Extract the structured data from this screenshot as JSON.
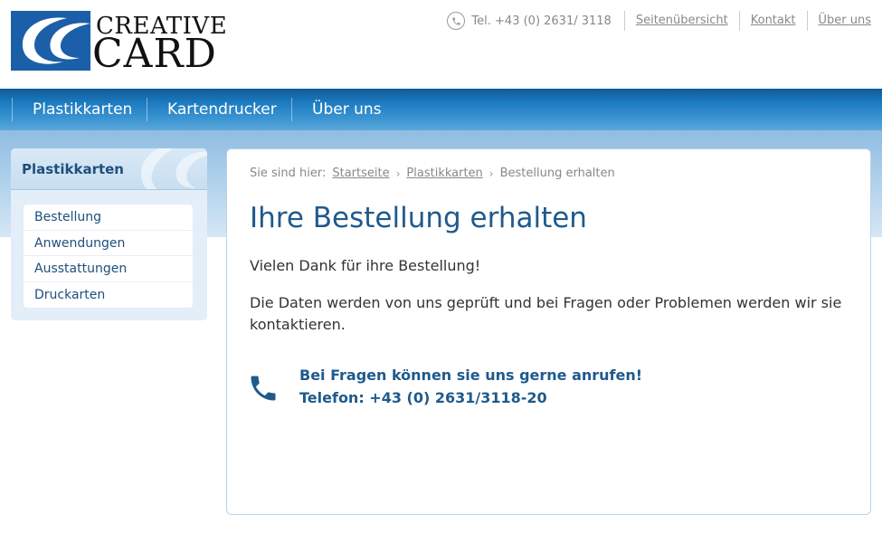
{
  "brand": {
    "name_top": "CREATIVE",
    "name_bottom": "CARD",
    "logo_icon": "cc-swoosh-logo-icon",
    "color_blue": "#1b5fa8"
  },
  "topnav": {
    "phone_icon": "phone-icon",
    "phone": "Tel. +43 (0) 2631/ 3118",
    "links": [
      "Seitenübersicht",
      "Kontakt",
      "Über uns"
    ]
  },
  "mainnav": {
    "items": [
      "Plastikkarten",
      "Kartendrucker",
      "Über uns"
    ]
  },
  "sidebar": {
    "title": "Plastikkarten",
    "items": [
      "Bestellung",
      "Anwendungen",
      "Ausstattungen",
      "Druckarten"
    ]
  },
  "breadcrumb": {
    "prefix": "Sie sind hier:",
    "items": [
      "Startseite",
      "Plastikkarten",
      "Bestellung erhalten"
    ]
  },
  "content": {
    "title": "Ihre Bestellung erhalten",
    "thanks": "Vielen Dank für ihre Bestellung!",
    "info": "Die Daten werden von uns geprüft und bei Fragen oder Problemen werden wir sie kontaktieren.",
    "contact_icon": "phone-icon",
    "contact_line1": "Bei Fragen können sie uns gerne anrufen!",
    "contact_line2": "Telefon: +43 (0) 2631/3118-20"
  }
}
